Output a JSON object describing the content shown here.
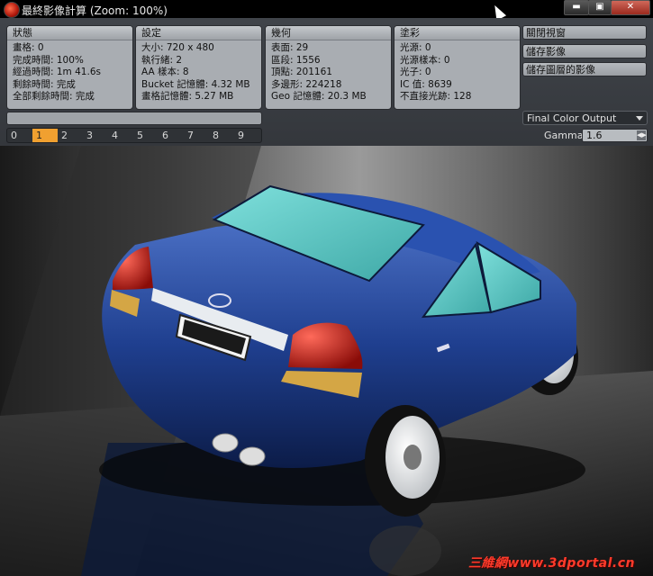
{
  "window": {
    "title": "最終影像計算 (Zoom: 100%)",
    "minimize_label": "▬",
    "maximize_label": "▣",
    "close_label": "✕"
  },
  "status": {
    "header": "狀態",
    "lines": [
      "畫格: 0",
      "完成時間: 100%",
      "經過時間: 1m 41.6s",
      "剩餘時間: 完成",
      "全部剩餘時間: 完成"
    ]
  },
  "settings": {
    "header": "設定",
    "lines": [
      "大小: 720 x 480",
      "執行緒: 2",
      "AA 樣本: 8",
      "Bucket 記憶體: 4.32 MB",
      "畫格記憶體: 5.27 MB"
    ]
  },
  "geometry": {
    "header": "幾何",
    "lines": [
      "表面: 29",
      "區段: 1556",
      "頂點: 201161",
      "多邊形: 224218",
      "Geo 記憶體: 20.3 MB"
    ]
  },
  "shading": {
    "header": "塗彩",
    "lines": [
      "光源: 0",
      "光源樣本: 0",
      "光子: 0",
      "IC 值: 8639",
      "不直接光跡: 128"
    ]
  },
  "actions": {
    "close_view": "關閉視窗",
    "save_image": "儲存影像",
    "save_layered": "儲存圖層的影像"
  },
  "progress_fraction": 1.0,
  "buckets": [
    "0",
    "1",
    "2",
    "3",
    "4",
    "5",
    "6",
    "7",
    "8",
    "9"
  ],
  "active_bucket": "1",
  "output": {
    "selected": "Final Color Output",
    "gamma_label": "Gamma",
    "gamma_value": "1.6"
  },
  "render": {
    "license_plate": "DANILSO-2010-8-2",
    "watermark": "三維網www.3dportal.cn"
  },
  "colors": {
    "accent": "#f0a030",
    "car_body": "#1f3f8f",
    "glass": "#5fc8c4"
  }
}
